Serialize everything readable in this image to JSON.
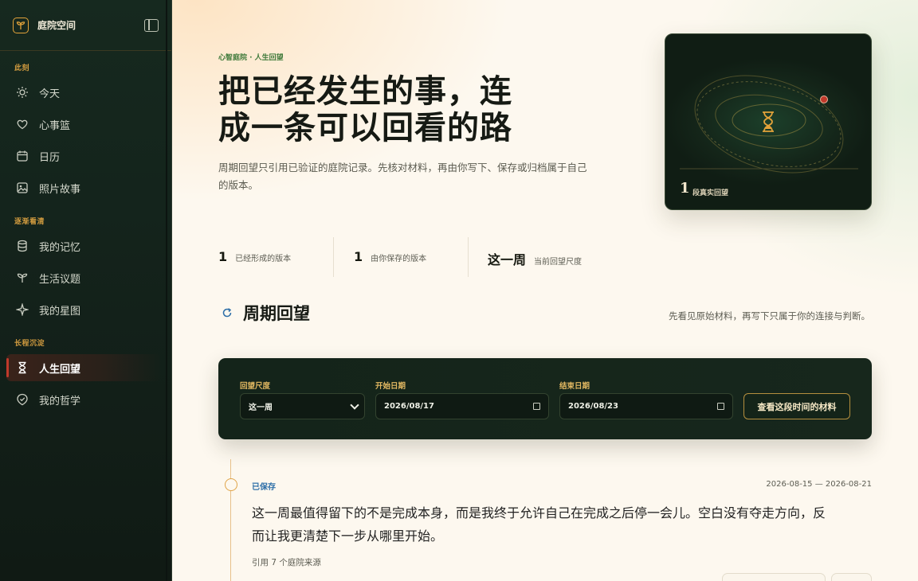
{
  "sidebar": {
    "brand": "庭院空间",
    "sections": [
      {
        "label": "此刻"
      },
      {
        "label": "逐渐看清"
      },
      {
        "label": "长程沉淀"
      }
    ],
    "items": [
      {
        "label": "今天",
        "icon": "sun-icon"
      },
      {
        "label": "心事篮",
        "icon": "heart-icon"
      },
      {
        "label": "日历",
        "icon": "calendar-icon"
      },
      {
        "label": "照片故事",
        "icon": "image-icon"
      },
      {
        "label": "我的记忆",
        "icon": "database-icon"
      },
      {
        "label": "生活议题",
        "icon": "sprout-icon"
      },
      {
        "label": "我的星图",
        "icon": "sparkle-icon"
      },
      {
        "label": "人生回望",
        "icon": "hourglass-icon",
        "active": true
      },
      {
        "label": "我的哲学",
        "icon": "badge-check-icon"
      }
    ]
  },
  "hero": {
    "breadcrumb": "心智庭院 · 人生回望",
    "title_line1": "把已经发生的事，连",
    "title_line2": "成一条可以回看的路",
    "description": "周期回望只引用已验证的庭院记录。先核对材料，再由你写下、保存或归档属于自己的版本。",
    "card_count": "1",
    "card_label": "段真实回望"
  },
  "stats": [
    {
      "value": "1",
      "label": "已经形成的版本"
    },
    {
      "value": "1",
      "label": "由你保存的版本"
    },
    {
      "value": "这一周",
      "label": "当前回望尺度"
    }
  ],
  "section": {
    "title": "周期回望",
    "hint": "先看见原始材料，再写下只属于你的连接与判断。"
  },
  "filter": {
    "scale_label": "回望尺度",
    "scale_value": "这一周",
    "start_label": "开始日期",
    "start_value": "2026/08/17",
    "end_label": "结束日期",
    "end_value": "2026/08/23",
    "button": "查看这段时间的材料"
  },
  "entry": {
    "status": "已保存",
    "range": "2026-08-15 — 2026-08-21",
    "text": "这一周最值得留下的不是完成本身，而是我终于允许自己在完成之后停一会儿。空白没有夺走方向，反而让我更清楚下一步从哪里开始。",
    "cite": "引用 7 个庭院来源"
  },
  "colors": {
    "sidebar_bg": "#14231a",
    "accent_amber": "#e3a33a",
    "active_marker": "#c0392b",
    "saved_blue": "#2e6fa8",
    "panel_bg": "#14241a"
  }
}
